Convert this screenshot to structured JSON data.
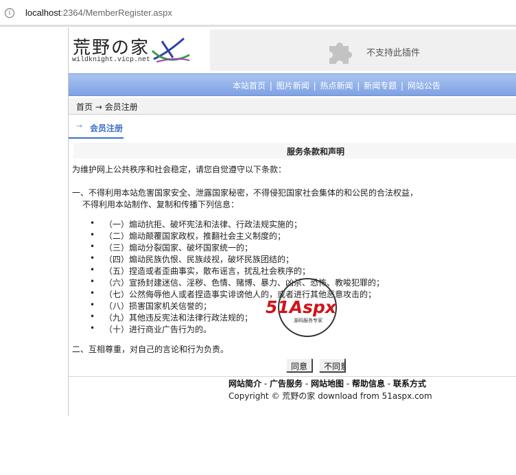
{
  "browser": {
    "url_host": "localhost",
    "url_rest": ":2364/MemberRegister.aspx"
  },
  "header": {
    "logo_cn": "荒野の家",
    "logo_en": "wildknight.vicp.net",
    "plugin_text": "不支持此插件"
  },
  "nav": {
    "items": [
      "本站首页",
      "图片新闻",
      "热点新闻",
      "新闻专题",
      "网站公告"
    ],
    "separator": "|"
  },
  "breadcrumb": {
    "home": "首页",
    "arrow": "→",
    "current": "会员注册"
  },
  "section": {
    "title": "会员注册"
  },
  "terms": {
    "heading": "服务条款和声明",
    "intro": "为维护网上公共秩序和社会稳定，请您自觉遵守以下条款：",
    "clause1_line1": "一、不得利用本站危害国家安全、泄露国家秘密，不得侵犯国家社会集体的和公民的合法权益，",
    "clause1_line2": "不得利用本站制作、复制和传播下列信息：",
    "items": [
      "（一）煽动抗拒、破坏宪法和法律、行政法规实施的；",
      "（二）煽动颠覆国家政权，推翻社会主义制度的；",
      "（三）煽动分裂国家、破坏国家统一的；",
      "（四）煽动民族仇恨、民族歧视，破坏民族团结的；",
      "（五）捏造或者歪曲事实，散布谣言，扰乱社会秩序的；",
      "（六）宣扬封建迷信、淫秽、色情、赌博、暴力、凶杀、恐怖、教唆犯罪的；",
      "（七）公然侮辱他人或者捏造事实诽谤他人的，或者进行其他恶意攻击的；",
      "（八）损害国家机关信誉的；",
      "（九）其他违反宪法和法律行政法规的；",
      "（十）进行商业广告行为的。"
    ],
    "clause2": "二、互相尊重，对自己的言论和行为负责。"
  },
  "buttons": {
    "agree": "同意",
    "disagree": "不同意"
  },
  "footer": {
    "links": [
      "网站简介",
      "广告服务",
      "网站地图",
      "帮助信息",
      "联系方式"
    ],
    "link_sep": " - ",
    "copyright": "Copyright © 荒野の家 download from 51aspx.com"
  },
  "watermark": {
    "brand": "51Aspx",
    "tagline": "源码服务专家"
  },
  "colors": {
    "nav_blue": "#7fa2e4",
    "accent_blue": "#3b6fc5",
    "watermark_red": "#d0131b",
    "watermark_green": "#2e8b2e"
  }
}
